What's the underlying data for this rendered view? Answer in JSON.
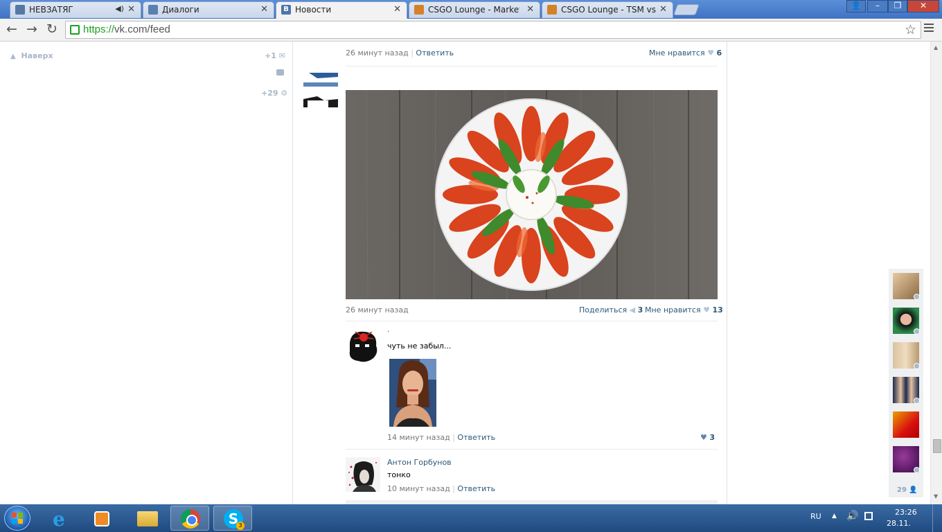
{
  "browser": {
    "tabs": [
      {
        "label": "НЕВЗАТЯГ",
        "color": "#5577a6",
        "active": false
      },
      {
        "label": "Диалоги",
        "color": "#5b7fb0",
        "active": false
      },
      {
        "label": "Новости",
        "color": "#4d76a8",
        "active": true
      },
      {
        "label": "CSGO Lounge - Marketpla",
        "color": "#d4822a",
        "active": false
      },
      {
        "label": "CSGO Lounge - TSM vs LG",
        "color": "#d4822a",
        "active": false
      }
    ],
    "url_scheme": "https://",
    "url_rest": "vk.com/feed"
  },
  "left": {
    "up_label": "Наверх",
    "messages_count": "+1",
    "notifications_count": "+29"
  },
  "feed": {
    "top_reply": {
      "time": "26 минут назад",
      "reply_label": "Ответить",
      "like_label": "Мне нравится",
      "likes": "6"
    },
    "post": {
      "time": "26 минут назад",
      "share_label": "Поделиться",
      "shares": "3",
      "like_label": "Мне нравится",
      "likes": "13"
    },
    "comments": [
      {
        "author": ".",
        "text": "чуть не забыл...",
        "time": "14 минут назад",
        "reply_label": "Ответить",
        "likes": "3"
      },
      {
        "author": "Антон Горбунов",
        "text": "тонко",
        "time": "10 минут назад",
        "reply_label": "Ответить"
      }
    ]
  },
  "friends": {
    "count": "29"
  },
  "taskbar": {
    "lang": "RU",
    "time": "23:26",
    "date": "28.11.",
    "skype_badge": "3"
  }
}
